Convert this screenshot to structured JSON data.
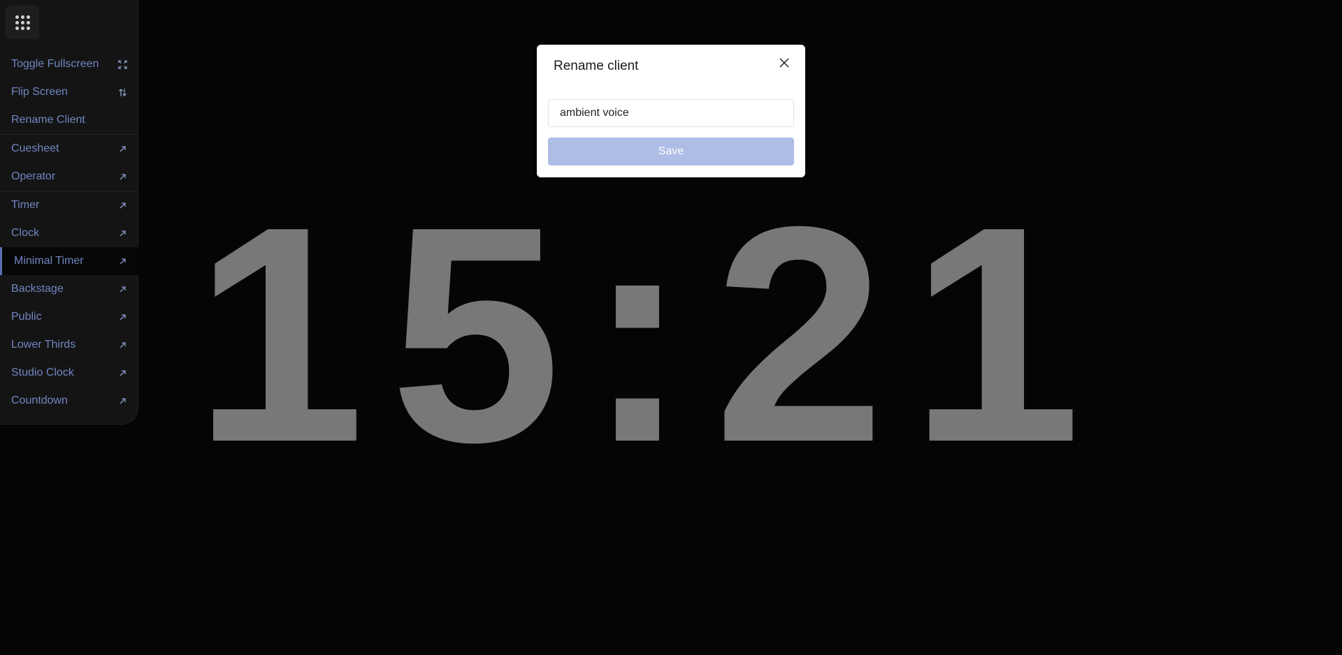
{
  "timer": {
    "display": "15:21"
  },
  "sidebar": {
    "apps_icon": "grid-dots-icon",
    "items": [
      {
        "label": "Toggle Fullscreen",
        "icon": "fullscreen-icon"
      },
      {
        "label": "Flip Screen",
        "icon": "flip-arrows-icon"
      },
      {
        "label": "Rename Client",
        "icon": ""
      },
      {
        "label": "Cuesheet",
        "icon": "external-arrow-icon"
      },
      {
        "label": "Operator",
        "icon": "external-arrow-icon"
      },
      {
        "label": "Timer",
        "icon": "external-arrow-icon"
      },
      {
        "label": "Clock",
        "icon": "external-arrow-icon"
      },
      {
        "label": "Minimal Timer",
        "icon": "external-arrow-icon",
        "active": true
      },
      {
        "label": "Backstage",
        "icon": "external-arrow-icon"
      },
      {
        "label": "Public",
        "icon": "external-arrow-icon"
      },
      {
        "label": "Lower Thirds",
        "icon": "external-arrow-icon"
      },
      {
        "label": "Studio Clock",
        "icon": "external-arrow-icon"
      },
      {
        "label": "Countdown",
        "icon": "external-arrow-icon"
      }
    ]
  },
  "modal": {
    "title": "Rename client",
    "close_icon": "close-icon",
    "input_value": "ambient voice",
    "save_label": "Save"
  },
  "colors": {
    "background": "#050505",
    "timer_digits": "#787878",
    "menu_text": "#6f86c0",
    "save_button": "#aebde6"
  }
}
